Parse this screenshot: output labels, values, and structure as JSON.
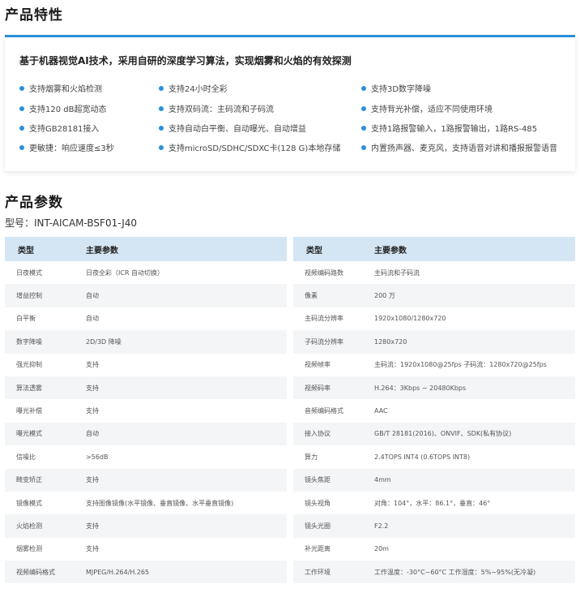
{
  "features": {
    "title": "产品特性",
    "headline": "基于机器视觉AI技术，采用自研的深度学习算法，实现烟雾和火焰的有效探测",
    "col1": [
      "支持烟雾和火焰检测",
      "支持120 dB超宽动态",
      "支持GB28181接入",
      "更敏捷：响应速度≤3秒"
    ],
    "col2": [
      "支持24小时全彩",
      "支持双码流：主码流和子码流",
      "支持自动白平衡、自动曝光、自动增益",
      "支持microSD/SDHC/SDXC卡(128 G)本地存储"
    ],
    "col3": [
      "支持3D数字降噪",
      "支持背光补偿，适应不同使用环境",
      "支持1路报警输入，1路报警输出，1路RS-485",
      "内置扬声器、麦克风，支持语音对讲和播报报警语音"
    ],
    "accent_color": "#2a90dc"
  },
  "params": {
    "title": "产品参数",
    "model": "型号：INT-AICAM-BSF01-J40",
    "header": {
      "type": "类型",
      "param": "主要参数"
    },
    "left_rows": [
      [
        "日夜模式",
        "日夜全彩（ICR 自动切换）"
      ],
      [
        "增益控制",
        "自动"
      ],
      [
        "白平衡",
        "自动"
      ],
      [
        "数字降噪",
        "2D/3D 降噪"
      ],
      [
        "强光抑制",
        "支持"
      ],
      [
        "算法透雾",
        "支持"
      ],
      [
        "曝光补偿",
        "支持"
      ],
      [
        "曝光模式",
        "自动"
      ],
      [
        "信噪比",
        ">56dB"
      ],
      [
        "畸变矫正",
        "支持"
      ],
      [
        "镜像模式",
        "支持图像镜像(水平镜像、垂直镜像、水平垂直镜像)"
      ],
      [
        "火焰检测",
        "支持"
      ],
      [
        "烟雾检测",
        "支持"
      ],
      [
        "视频编码格式",
        "MJPEG/H.264/H.265"
      ]
    ],
    "right_rows": [
      [
        "视频编码路数",
        "主码流和子码流"
      ],
      [
        "像素",
        "200 万"
      ],
      [
        "主码流分辨率",
        "1920x1080/1280x720"
      ],
      [
        "子码流分辨率",
        "1280x720"
      ],
      [
        "视频帧率",
        "主码流：1920x1080@25fps    子码流：1280x720@25fps"
      ],
      [
        "视频码率",
        "H.264：3Kbps ~ 20480Kbps"
      ],
      [
        "音频编码格式",
        "AAC"
      ],
      [
        "接入协议",
        "GB/T 28181(2016)、ONVIF、SDK(私有协议)"
      ],
      [
        "算力",
        "2.4TOPS INT4 (0.6TOPS INT8)"
      ],
      [
        "镜头焦距",
        "4mm"
      ],
      [
        "镜头视角",
        "对角：104°，水平：86.1°，垂直：46°"
      ],
      [
        "镜头光圈",
        "F2.2"
      ],
      [
        "补光距离",
        "20m"
      ],
      [
        "工作环境",
        "工作温度：-30°C~60°C    工作湿度：5%~95%(无冷凝)"
      ]
    ],
    "header_color": "#d4e6f4",
    "alt_row_color": "#f4f5f7"
  }
}
